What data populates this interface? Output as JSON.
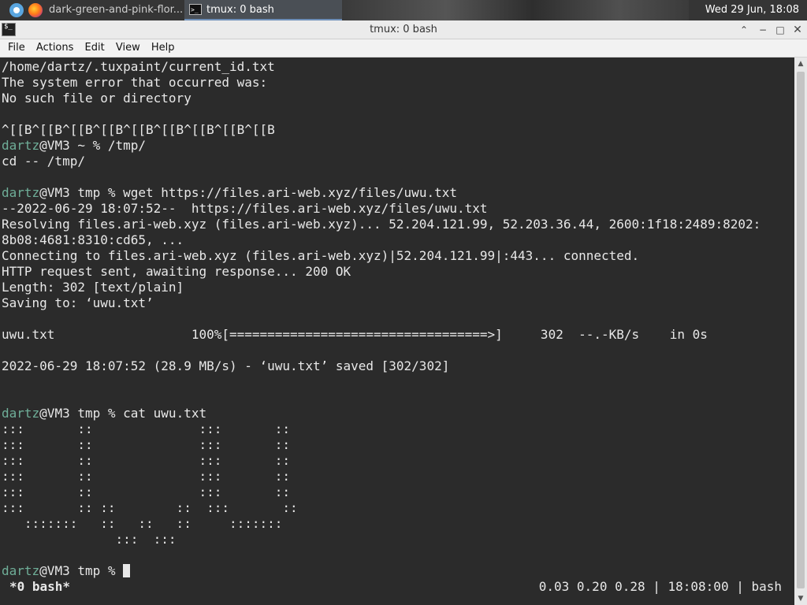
{
  "panel": {
    "firefox_task": "dark-green-and-pink-flor...",
    "terminal_task": "tmux: 0 bash",
    "clock": "Wed 29 Jun, 18:08"
  },
  "window": {
    "title": "tmux: 0 bash"
  },
  "menu": [
    "File",
    "Actions",
    "Edit",
    "View",
    "Help"
  ],
  "terminal": {
    "lines": [
      {
        "text": "/home/dartz/.tuxpaint/current_id.txt"
      },
      {
        "text": "The system error that occurred was:"
      },
      {
        "text": "No such file or directory"
      },
      {
        "text": ""
      },
      {
        "text": "^[[B^[[B^[[B^[[B^[[B^[[B^[[B^[[B^[[B"
      },
      {
        "user": "dartz",
        "text": "@VM3 ~ % /tmp/"
      },
      {
        "text": "cd -- /tmp/"
      },
      {
        "text": ""
      },
      {
        "user": "dartz",
        "text": "@VM3 tmp % wget https://files.ari-web.xyz/files/uwu.txt"
      },
      {
        "text": "--2022-06-29 18:07:52--  https://files.ari-web.xyz/files/uwu.txt"
      },
      {
        "text": "Resolving files.ari-web.xyz (files.ari-web.xyz)... 52.204.121.99, 52.203.36.44, 2600:1f18:2489:8202:"
      },
      {
        "text": "8b08:4681:8310:cd65, ..."
      },
      {
        "text": "Connecting to files.ari-web.xyz (files.ari-web.xyz)|52.204.121.99|:443... connected."
      },
      {
        "text": "HTTP request sent, awaiting response... 200 OK"
      },
      {
        "text": "Length: 302 [text/plain]"
      },
      {
        "text": "Saving to: ‘uwu.txt’"
      },
      {
        "text": ""
      },
      {
        "text": "uwu.txt                  100%[==================================>]     302  --.-KB/s    in 0s"
      },
      {
        "text": ""
      },
      {
        "text": "2022-06-29 18:07:52 (28.9 MB/s) - ‘uwu.txt’ saved [302/302]"
      },
      {
        "text": ""
      },
      {
        "text": ""
      },
      {
        "user": "dartz",
        "text": "@VM3 tmp % cat uwu.txt"
      },
      {
        "text": ":::       ::              :::       ::"
      },
      {
        "text": ":::       ::              :::       ::"
      },
      {
        "text": ":::       ::              :::       ::"
      },
      {
        "text": ":::       ::              :::       ::"
      },
      {
        "text": ":::       ::              :::       ::"
      },
      {
        "text": ":::       :: ::        ::  :::       ::"
      },
      {
        "text": "   :::::::   ::   ::   ::     :::::::"
      },
      {
        "text": "               :::  :::"
      },
      {
        "text": ""
      },
      {
        "user": "dartz",
        "text": "@VM3 tmp % ",
        "cursor": true
      }
    ],
    "status_window": "*0 bash*",
    "status_right": "0.03 0.20 0.28 | 18:08:00 | bash"
  }
}
